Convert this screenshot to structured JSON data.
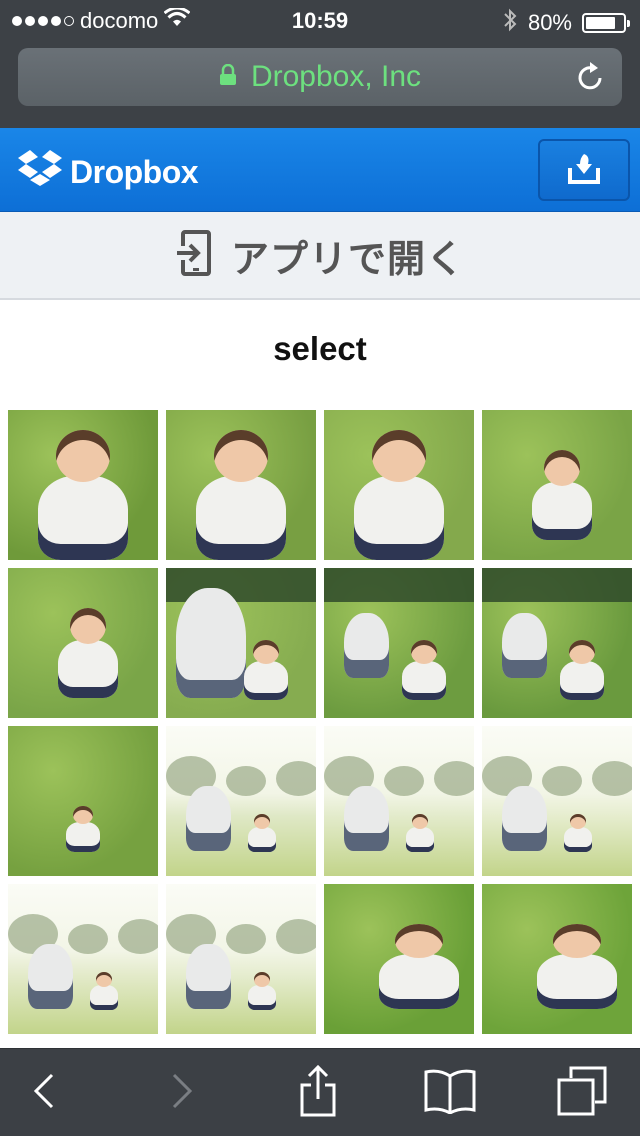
{
  "status_bar": {
    "carrier": "docomo",
    "signal_bars": 4,
    "signal_total": 5,
    "time": "10:59",
    "battery_percent": "80%",
    "battery_level": 0.8
  },
  "address_bar": {
    "title": "Dropbox, Inc",
    "secure": true,
    "text_color": "#6de07f"
  },
  "header": {
    "brand": "Dropbox",
    "color": "#1a86e8"
  },
  "open_in_app": {
    "label": "アプリで開く"
  },
  "folder": {
    "title": "select"
  },
  "photos": [
    {
      "scene": "baby-close",
      "bg": "#6f9a3a"
    },
    {
      "scene": "baby-close",
      "bg": "#789f42"
    },
    {
      "scene": "baby-close",
      "bg": "#84a94c"
    },
    {
      "scene": "baby-sit",
      "bg": "#7aa446"
    },
    {
      "scene": "baby-sit",
      "bg": "#7aa548"
    },
    {
      "scene": "adult-baby-close",
      "bg": "#86ac50"
    },
    {
      "scene": "adult-baby",
      "bg": "#6d9c40"
    },
    {
      "scene": "adult-baby",
      "bg": "#6a9a3e"
    },
    {
      "scene": "baby-far",
      "bg": "#76a140"
    },
    {
      "scene": "bright-park",
      "bg": "#dfe8c6"
    },
    {
      "scene": "bright-park",
      "bg": "#e3ebcb"
    },
    {
      "scene": "bright-park",
      "bg": "#e6edce"
    },
    {
      "scene": "bright-park-group",
      "bg": "#e4ebcb"
    },
    {
      "scene": "bright-park-group",
      "bg": "#e6edd0"
    },
    {
      "scene": "baby-crawl",
      "bg": "#6aa037"
    },
    {
      "scene": "baby-crawl",
      "bg": "#6ea43a"
    }
  ],
  "toolbar": {
    "items": [
      "back",
      "forward",
      "share",
      "bookmarks",
      "tabs"
    ]
  }
}
